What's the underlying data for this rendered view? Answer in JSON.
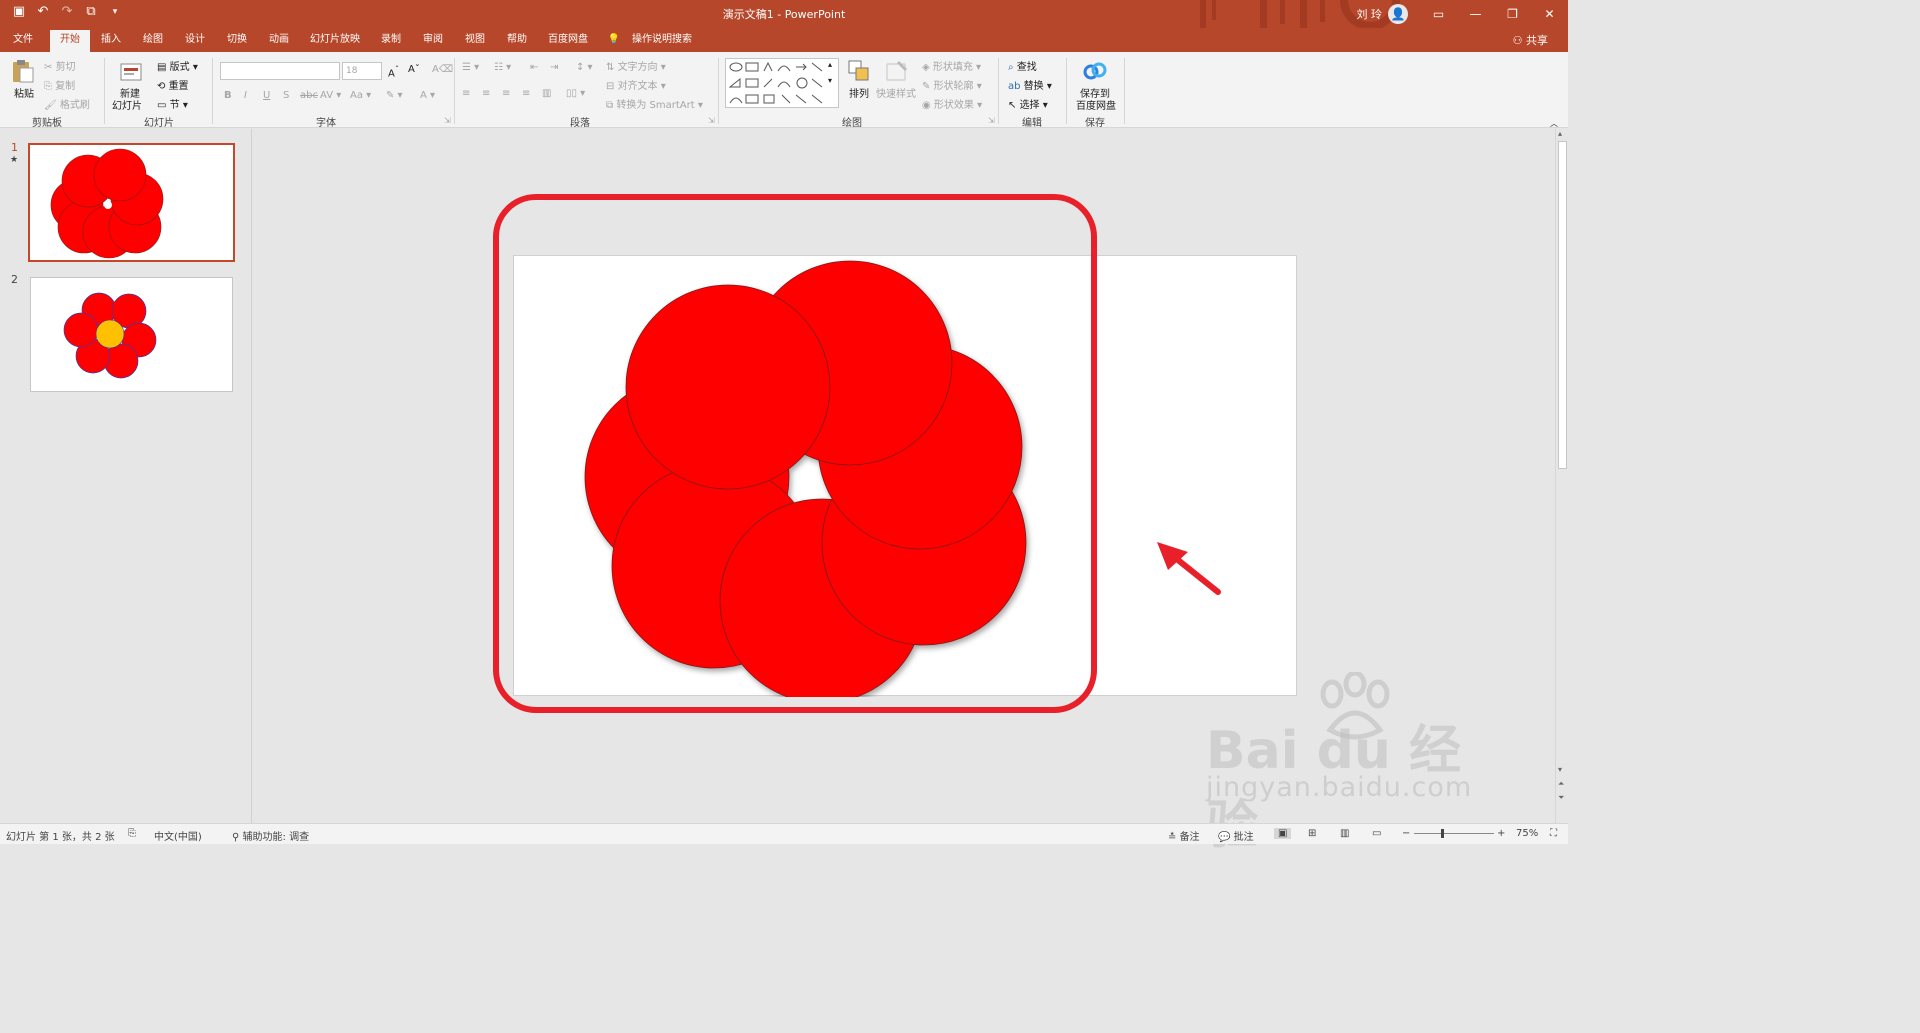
{
  "titlebar": {
    "title": "演示文稿1  -  PowerPoint",
    "user": "刘 玲",
    "qat": [
      "save-icon",
      "undo-icon",
      "redo-icon",
      "present-icon",
      "customize-icon"
    ]
  },
  "tabs": [
    {
      "label": "文件",
      "active": false
    },
    {
      "label": "开始",
      "active": true
    },
    {
      "label": "插入",
      "active": false
    },
    {
      "label": "绘图",
      "active": false
    },
    {
      "label": "设计",
      "active": false
    },
    {
      "label": "切换",
      "active": false
    },
    {
      "label": "动画",
      "active": false
    },
    {
      "label": "幻灯片放映",
      "active": false
    },
    {
      "label": "录制",
      "active": false
    },
    {
      "label": "审阅",
      "active": false
    },
    {
      "label": "视图",
      "active": false
    },
    {
      "label": "帮助",
      "active": false
    },
    {
      "label": "百度网盘",
      "active": false
    }
  ],
  "tell_me": "操作说明搜索",
  "share": "共享",
  "ribbon": {
    "clipboard": {
      "paste": "粘贴",
      "cut": "剪切",
      "copy": "复制",
      "format_painter": "格式刷",
      "label": "剪贴板"
    },
    "slides": {
      "new_slide_1": "新建",
      "new_slide_2": "幻灯片",
      "layout": "版式",
      "reset": "重置",
      "section": "节",
      "label": "幻灯片"
    },
    "font": {
      "size": "18",
      "label": "字体"
    },
    "paragraph": {
      "text_direction": "文字方向",
      "align_text": "对齐文本",
      "smartart": "转换为 SmartArt",
      "label": "段落"
    },
    "drawing": {
      "arrange": "排列",
      "quick_styles": "快速样式",
      "fill": "形状填充",
      "outline": "形状轮廓",
      "effects": "形状效果",
      "label": "绘图"
    },
    "editing": {
      "find": "查找",
      "replace": "替换",
      "select": "选择",
      "label": "编辑"
    },
    "save": {
      "save_1": "保存到",
      "save_2": "百度网盘",
      "label": "保存"
    }
  },
  "slides_pane": [
    {
      "number": "1",
      "star": "★",
      "selected": true
    },
    {
      "number": "2",
      "selected": false
    }
  ],
  "colors": {
    "accent": "#b7472a",
    "petal": "#ff0000",
    "center": "#ffc000",
    "highlight_frame": "#e8202a"
  },
  "watermark": {
    "big": "Bai du 经验",
    "small": "jingyan.baidu.com"
  },
  "status": {
    "slide_info": "幻灯片 第 1 张，共 2 张",
    "language": "中文(中国)",
    "accessibility": "辅助功能: 调查",
    "notes": "备注",
    "comments": "批注",
    "zoom": "75%"
  }
}
